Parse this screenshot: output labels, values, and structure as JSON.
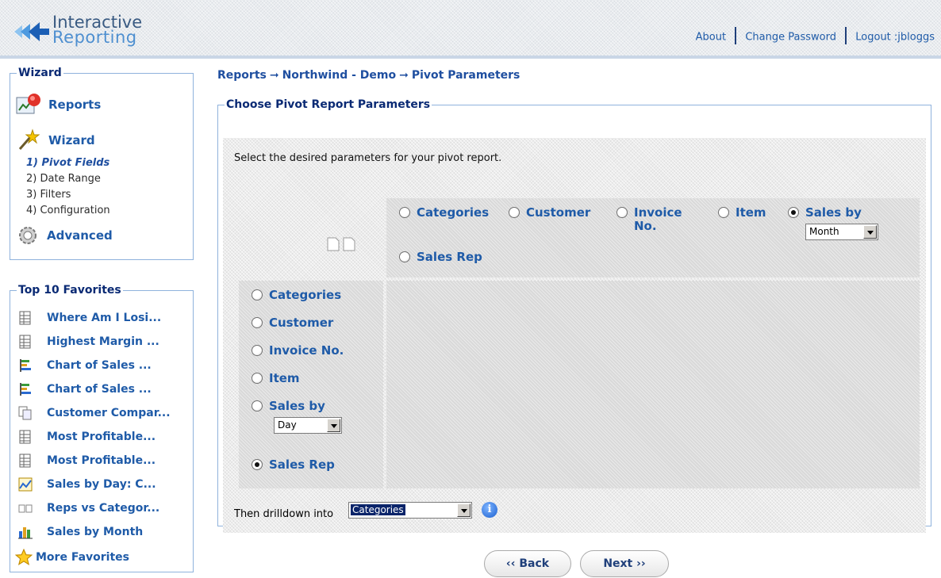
{
  "header": {
    "logo_line1": "Interactive",
    "logo_line2": "Reporting",
    "links": {
      "about": "About",
      "change_password": "Change Password",
      "logout": "Logout :jbloggs"
    }
  },
  "wizard_panel": {
    "title": "Wizard",
    "reports_label": "Reports",
    "wizard_label": "Wizard",
    "steps": [
      "1) Pivot Fields",
      "2) Date Range",
      "3) Filters",
      "4) Configuration"
    ],
    "advanced_label": "Advanced"
  },
  "favorites": {
    "title": "Top 10 Favorites",
    "items": [
      {
        "label": "Where Am I Losi...",
        "icon": "table-icon"
      },
      {
        "label": "Highest Margin ...",
        "icon": "table-icon"
      },
      {
        "label": "Chart of Sales ...",
        "icon": "bar-chart-icon"
      },
      {
        "label": "Chart of Sales ...",
        "icon": "bar-chart-icon"
      },
      {
        "label": "Customer Compar...",
        "icon": "compare-docs-icon"
      },
      {
        "label": "Most Profitable...",
        "icon": "table-icon"
      },
      {
        "label": "Most Profitable...",
        "icon": "table-icon"
      },
      {
        "label": "Sales by Day: C...",
        "icon": "line-chart-icon"
      },
      {
        "label": "Reps vs Categor...",
        "icon": "pivot-icon"
      },
      {
        "label": "Sales by Month",
        "icon": "column-chart-icon"
      }
    ],
    "more_label": "More Favorites"
  },
  "breadcrumb": [
    "Reports",
    "Northwind - Demo",
    "Pivot Parameters"
  ],
  "main": {
    "title": "Choose Pivot Report Parameters",
    "intro": "Select the desired parameters for your pivot report.",
    "column_options": [
      {
        "label": "Categories",
        "selected": false
      },
      {
        "label": "Customer",
        "selected": false
      },
      {
        "label": "Invoice No.",
        "selected": false
      },
      {
        "label": "Item",
        "selected": false
      },
      {
        "label": "Sales by",
        "selected": true,
        "select_value": "Month"
      },
      {
        "label": "Sales Rep",
        "selected": false
      }
    ],
    "row_options": [
      {
        "label": "Categories",
        "selected": false
      },
      {
        "label": "Customer",
        "selected": false
      },
      {
        "label": "Invoice No.",
        "selected": false
      },
      {
        "label": "Item",
        "selected": false
      },
      {
        "label": "Sales by",
        "selected": false,
        "select_value": "Day"
      },
      {
        "label": "Sales Rep",
        "selected": true
      }
    ],
    "drilldown_label": "Then drilldown into",
    "drilldown_value": "Categories"
  },
  "nav": {
    "back": "‹‹ Back",
    "next": "Next ››"
  },
  "colors": {
    "link": "#1f5ba8",
    "legend": "#0a2a74",
    "border": "#8fb2dc"
  }
}
